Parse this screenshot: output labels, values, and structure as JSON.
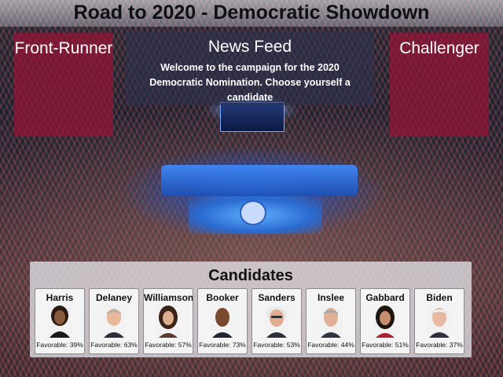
{
  "game": {
    "title": "Road to 2020 - Democratic Showdown"
  },
  "front_runner": {
    "label": "Front-Runner"
  },
  "challenger": {
    "label": "Challenger"
  },
  "news_feed": {
    "heading": "News Feed",
    "message": "Welcome to the campaign for the 2020 Democratic Nomination. Choose yourself a candidate"
  },
  "candidates_panel": {
    "heading": "Candidates",
    "candidates": [
      {
        "name": "Harris",
        "favorable": "Favorable: 39%"
      },
      {
        "name": "Delaney",
        "favorable": "Favorable: 63%"
      },
      {
        "name": "Williamson",
        "favorable": "Favorable: 57%"
      },
      {
        "name": "Booker",
        "favorable": "Favorable: 73%"
      },
      {
        "name": "Sanders",
        "favorable": "Favorable: 53%"
      },
      {
        "name": "Inslee",
        "favorable": "Favorable: 44%"
      },
      {
        "name": "Gabbard",
        "favorable": "Favorable: 51%"
      },
      {
        "name": "Biden",
        "favorable": "Favorable: 37%"
      }
    ]
  },
  "colors": {
    "side_panel": "#961437",
    "news_panel": "#2d3250",
    "candidates_panel": "#e1e1e8"
  }
}
